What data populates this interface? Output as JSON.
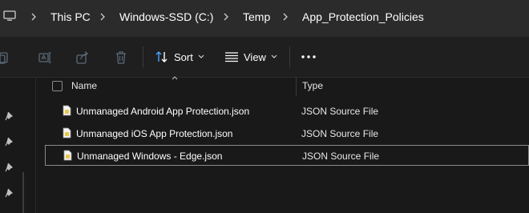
{
  "breadcrumb": {
    "items": [
      "This PC",
      "Windows-SSD (C:)",
      "Temp",
      "App_Protection_Policies"
    ]
  },
  "toolbar": {
    "sort_label": "Sort",
    "view_label": "View"
  },
  "columns": {
    "name": "Name",
    "type": "Type"
  },
  "files": [
    {
      "name": "Unmanaged Android App Protection.json",
      "type": "JSON Source File"
    },
    {
      "name": "Unmanaged iOS App Protection.json",
      "type": "JSON Source File"
    },
    {
      "name": "Unmanaged Windows - Edge.json",
      "type": "JSON Source File"
    }
  ],
  "colors": {
    "background": "#191919",
    "toolbar": "#1f1f1f",
    "address_bar": "#2b2b2b",
    "accent_blue": "#4aa3ff",
    "json_icon": "#e8c84a"
  }
}
